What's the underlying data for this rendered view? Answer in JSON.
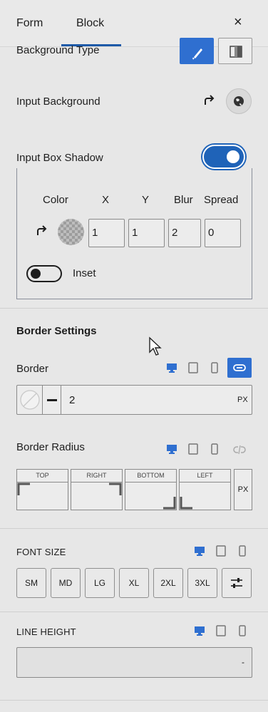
{
  "tabs": [
    {
      "label": "Form"
    },
    {
      "label": "Block"
    }
  ],
  "close_glyph": "×",
  "background_type": {
    "label": "Background Type"
  },
  "input_background": {
    "label": "Input Background"
  },
  "input_box_shadow": {
    "label": "Input Box Shadow",
    "enabled": true,
    "columns": [
      "Color",
      "X",
      "Y",
      "Blur",
      "Spread"
    ],
    "values": {
      "x": "1",
      "y": "1",
      "blur": "2",
      "spread": "0"
    },
    "inset_label": "Inset",
    "inset": false
  },
  "border_settings": {
    "heading": "Border Settings"
  },
  "border": {
    "label": "Border",
    "width_value": "2",
    "unit": "PX"
  },
  "border_radius": {
    "label": "Border Radius",
    "corners": [
      "TOP",
      "RIGHT",
      "BOTTOM",
      "LEFT"
    ],
    "unit": "PX"
  },
  "font_size": {
    "label": "FONT SIZE",
    "options": [
      "SM",
      "MD",
      "LG",
      "XL",
      "2XL",
      "3XL"
    ]
  },
  "line_height": {
    "label": "LINE HEIGHT",
    "value": "-"
  },
  "colors": {
    "accent": "#2f6fd0",
    "toggle": "#1f63b8",
    "background": "#e7e7e7"
  },
  "icons": [
    "paintbrush-icon",
    "gradient-icon",
    "reset-icon",
    "globe-icon",
    "desktop-icon",
    "tablet-icon",
    "mobile-icon",
    "link-icon",
    "unlink-icon",
    "sliders-icon",
    "close-icon"
  ]
}
